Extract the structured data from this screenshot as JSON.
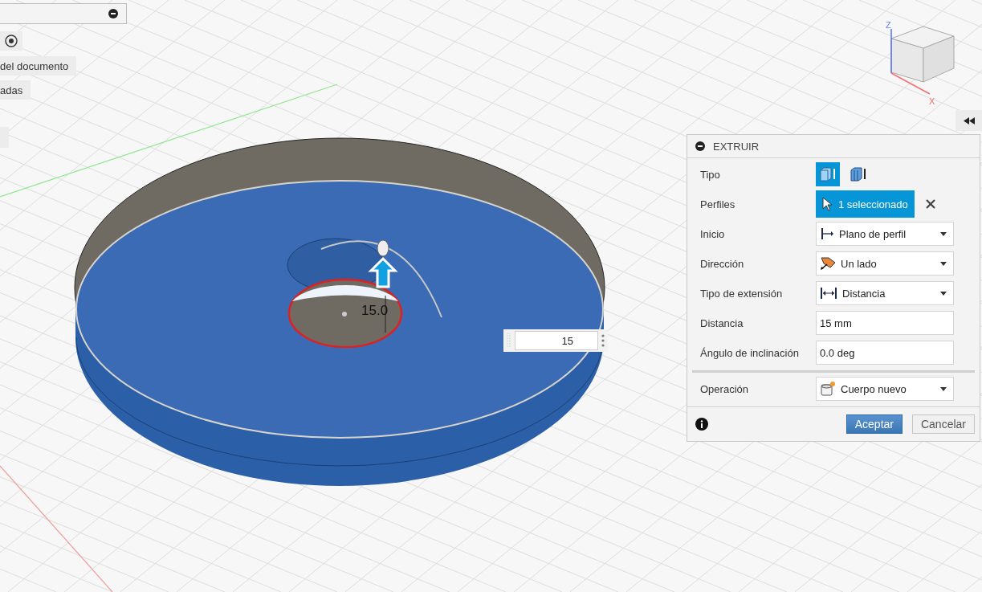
{
  "browser": {
    "rows": [
      {
        "label": "del documento"
      },
      {
        "label": "adas"
      }
    ]
  },
  "viewcube": {
    "axes": [
      "Z",
      "X"
    ]
  },
  "dimension": {
    "label": "15.0"
  },
  "distance_input": {
    "value": "15"
  },
  "dialog": {
    "title": "EXTRUIR",
    "sections": [
      [
        {
          "kind": "toggle",
          "label": "Tipo",
          "options": [
            {
              "selected": true
            },
            {
              "selected": false
            }
          ]
        },
        {
          "kind": "selection",
          "label": "Perfiles",
          "value": "1 seleccionado"
        },
        {
          "kind": "dropdown",
          "label": "Inicio",
          "value": "Plano de perfil"
        },
        {
          "kind": "dropdown",
          "label": "Dirección",
          "value": "Un lado"
        },
        {
          "kind": "dropdown",
          "label": "Tipo de extensión",
          "value": "Distancia"
        },
        {
          "kind": "input",
          "label": "Distancia",
          "value": "15 mm"
        },
        {
          "kind": "input",
          "label": "Ángulo de inclinación",
          "value": "0.0 deg"
        }
      ],
      [
        {
          "kind": "dropdown",
          "label": "Operación",
          "value": "Cuerpo nuevo"
        }
      ]
    ],
    "buttons": [
      {
        "label": "Aceptar",
        "primary": true
      },
      {
        "label": "Cancelar",
        "primary": false
      }
    ]
  }
}
